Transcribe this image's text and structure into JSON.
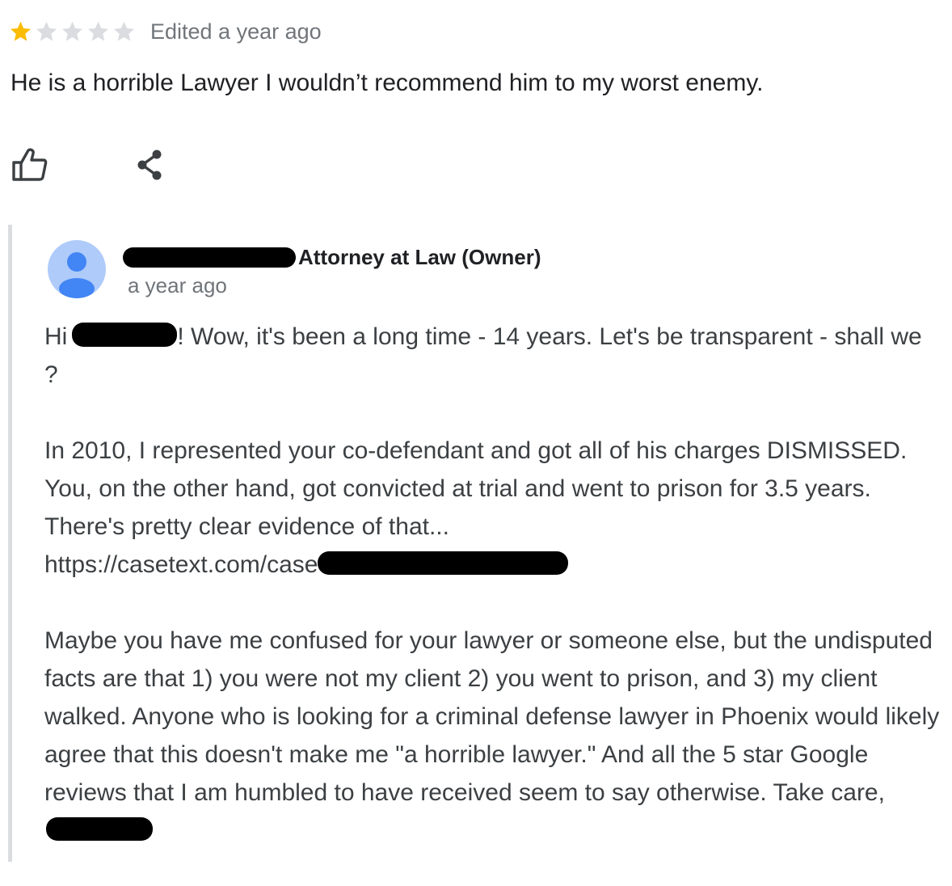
{
  "review": {
    "rating": 1,
    "max_rating": 5,
    "star_filled_color": "#fbbc04",
    "star_empty_color": "#dadce0",
    "edited": "Edited a year ago",
    "text": "He is a horrible Lawyer I wouldn’t recommend him to my worst enemy.",
    "actions": {
      "like_icon": "thumbs-up-icon",
      "share_icon": "share-icon"
    }
  },
  "owner_response": {
    "title": "Attorney at Law (Owner)",
    "time": "a year ago",
    "avatar_icon": "person-icon",
    "avatar_color": "#aecbfa",
    "avatar_figure_color": "#4285f4",
    "p1_start": "Hi",
    "p1_rest": "! Wow, it's been a long time - 14 years. Let's be transparent - shall we ?",
    "p2_text": "In 2010, I represented your co-defendant and got all of his charges DISMISSED. You, on the other hand, got convicted at trial and went to prison for 3.5 years. There's pretty clear evidence of that...",
    "p2_link": "https://casetext.com/case",
    "p3_text": "Maybe you have me confused for your lawyer or someone else, but the undisputed facts are that 1) you were not my client 2) you went to prison, and 3) my client walked. Anyone who is looking for a criminal defense lawyer in Phoenix would likely agree that this doesn't make me \"a horrible lawyer.\" And all the 5 star Google reviews that I am humbled to have received seem to say otherwise. Take care,"
  }
}
